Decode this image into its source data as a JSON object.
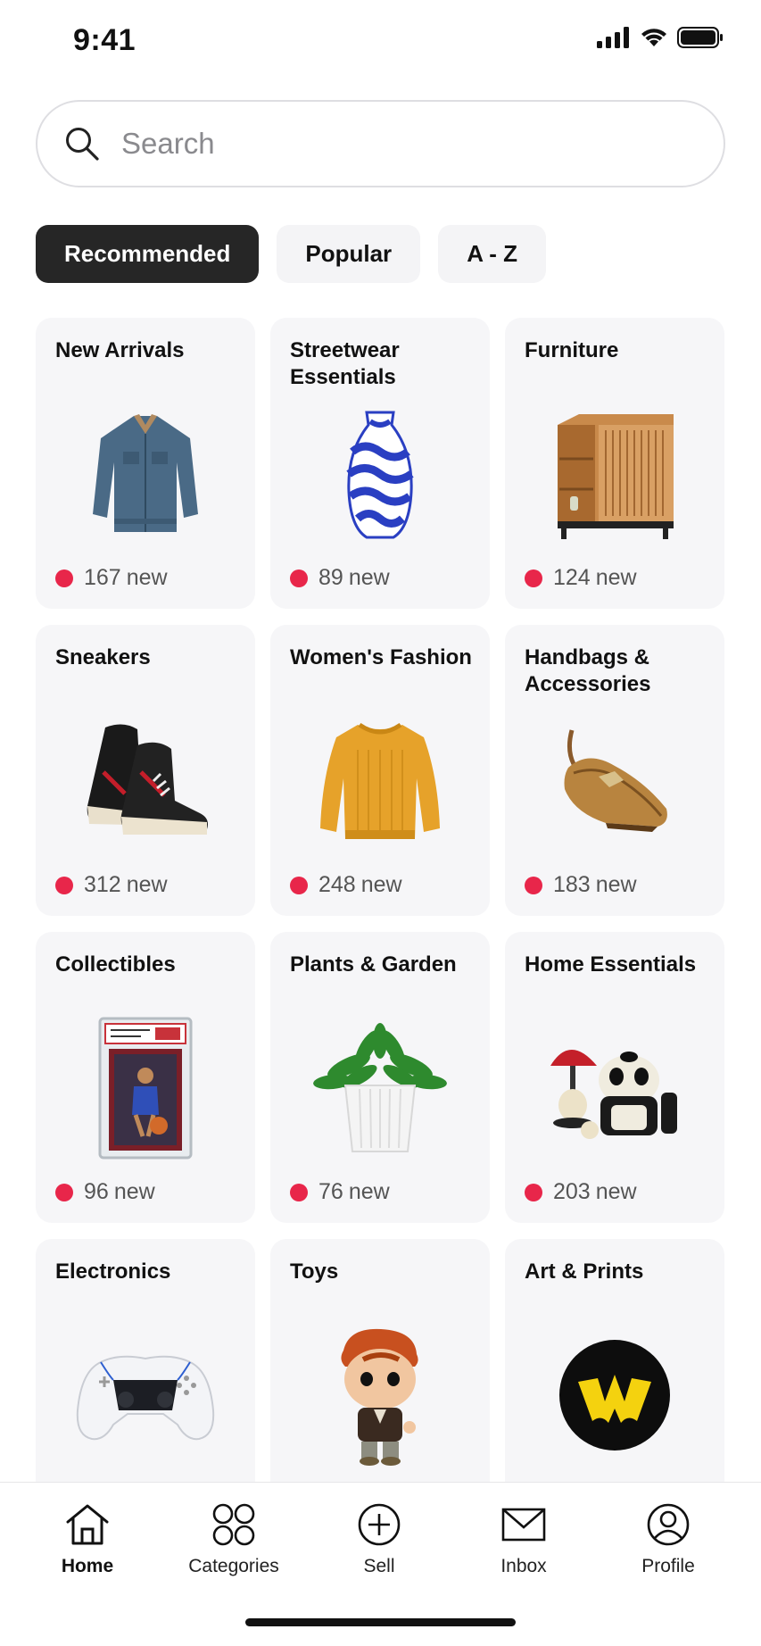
{
  "status_bar": {
    "time": "9:41"
  },
  "search": {
    "placeholder": "Search"
  },
  "chips": [
    {
      "label": "Recommended",
      "active": true
    },
    {
      "label": "Popular",
      "active": false
    },
    {
      "label": "A - Z",
      "active": false
    }
  ],
  "categories": [
    {
      "title": "New Arrivals",
      "count": "167",
      "suffix": "new",
      "icon": "denim-jacket-icon"
    },
    {
      "title": "Streetwear Essentials",
      "count": "89",
      "suffix": "new",
      "icon": "blue-vase-icon"
    },
    {
      "title": "Furniture",
      "count": "124",
      "suffix": "new",
      "icon": "wooden-cabinet-icon"
    },
    {
      "title": "Sneakers",
      "count": "312",
      "suffix": "new",
      "icon": "sneakers-icon"
    },
    {
      "title": "Women's Fashion",
      "count": "248",
      "suffix": "new",
      "icon": "yellow-sweater-icon"
    },
    {
      "title": "Handbags & Accessories",
      "count": "183",
      "suffix": "new",
      "icon": "handbag-icon"
    },
    {
      "title": "Collectibles",
      "count": "96",
      "suffix": "new",
      "icon": "graded-card-icon"
    },
    {
      "title": "Plants & Garden",
      "count": "76",
      "suffix": "new",
      "icon": "potted-plant-icon"
    },
    {
      "title": "Home Essentials",
      "count": "203",
      "suffix": "new",
      "icon": "home-decor-icon"
    },
    {
      "title": "Electronics",
      "count": "",
      "suffix": "",
      "icon": "game-controller-icon"
    },
    {
      "title": "Toys",
      "count": "",
      "suffix": "",
      "icon": "toy-figure-icon"
    },
    {
      "title": "Art & Prints",
      "count": "",
      "suffix": "",
      "icon": "art-print-icon"
    }
  ],
  "nav": [
    {
      "label": "Home",
      "icon": "home-icon",
      "active": true
    },
    {
      "label": "Categories",
      "icon": "categories-icon",
      "active": false
    },
    {
      "label": "Sell",
      "icon": "sell-plus-icon",
      "active": false
    },
    {
      "label": "Inbox",
      "icon": "inbox-mail-icon",
      "active": false
    },
    {
      "label": "Profile",
      "icon": "profile-icon",
      "active": false
    }
  ],
  "colors": {
    "accent_dot": "#e8264a",
    "active_chip": "#262626",
    "card_bg": "#f6f6f8"
  }
}
